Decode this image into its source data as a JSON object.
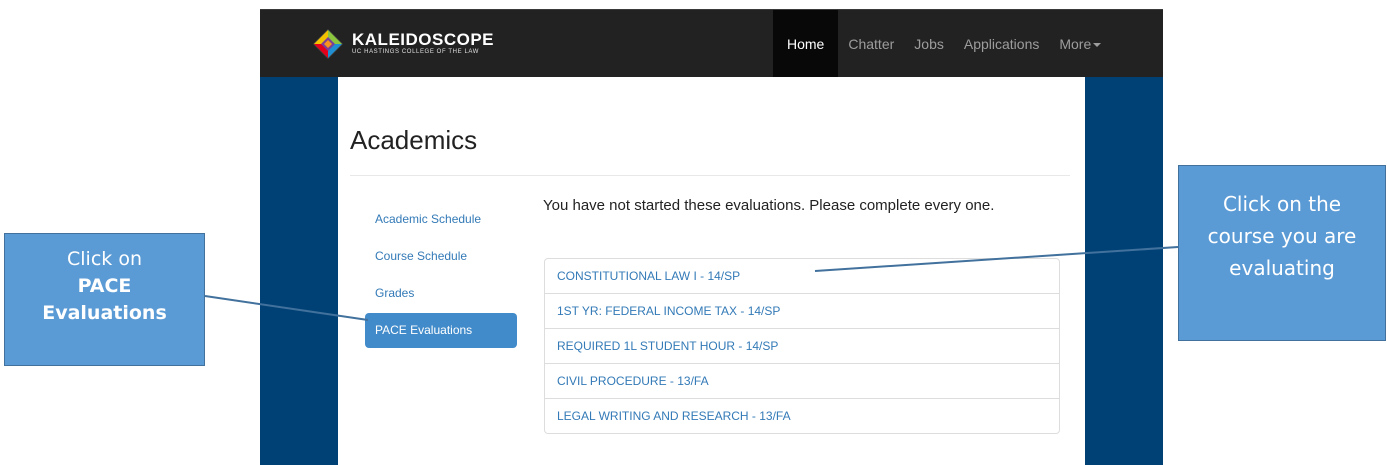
{
  "header": {
    "brand_name": "KALEIDOSCOPE",
    "brand_sub": "UC HASTINGS COLLEGE OF THE LAW",
    "nav": [
      {
        "label": "Home",
        "active": true
      },
      {
        "label": "Chatter"
      },
      {
        "label": "Jobs"
      },
      {
        "label": "Applications"
      },
      {
        "label": "More"
      }
    ]
  },
  "main": {
    "title": "Academics",
    "intro": "You have not started these evaluations. Please complete every one.",
    "sidebar": [
      {
        "label": "Academic Schedule"
      },
      {
        "label": "Course Schedule"
      },
      {
        "label": "Grades"
      },
      {
        "label": "PACE Evaluations",
        "active": true
      }
    ],
    "courses": [
      "CONSTITUTIONAL LAW I - 14/SP",
      "1ST YR: FEDERAL INCOME TAX - 14/SP",
      "REQUIRED 1L STUDENT HOUR - 14/SP",
      "CIVIL PROCEDURE - 13/FA",
      "LEGAL WRITING AND RESEARCH - 13/FA"
    ]
  },
  "callouts": {
    "left": {
      "line1": "Click on",
      "line2": "PACE",
      "line3": "Evaluations"
    },
    "right": {
      "line1": "Click on the",
      "line2": "course you are",
      "line3": "evaluating"
    }
  },
  "colors": {
    "navbar": "#222222",
    "side_band": "#004175",
    "link": "#337ab7",
    "active_pill": "#428bca",
    "callout": "#5b9bd5"
  },
  "icons": {
    "brand_logo": "kaleidoscope-logo-icon",
    "more_caret": "caret-down-icon"
  }
}
